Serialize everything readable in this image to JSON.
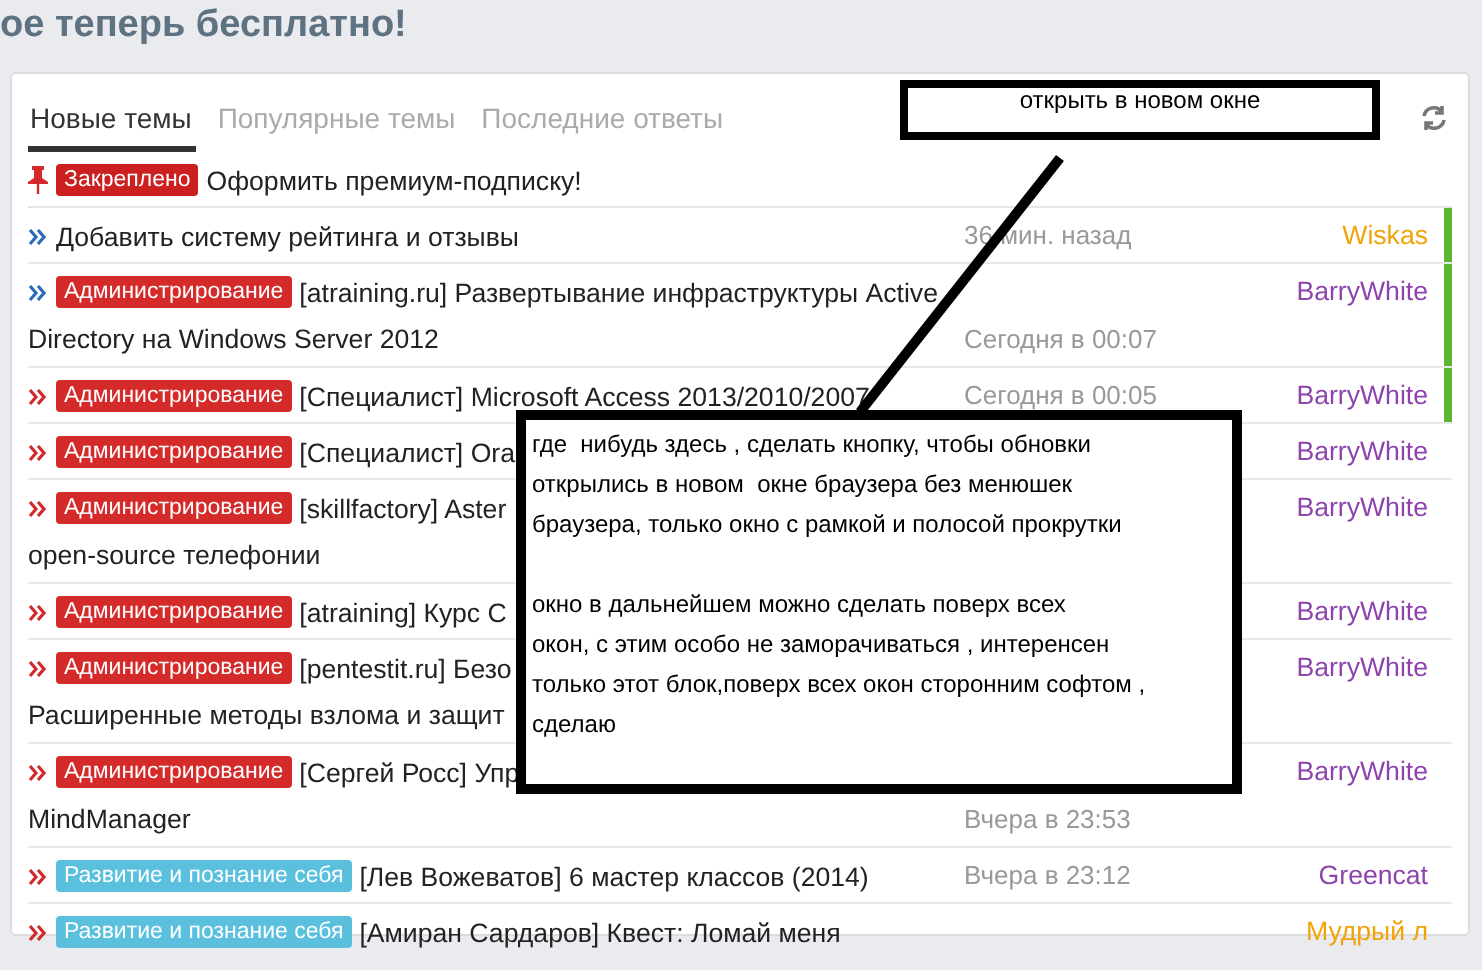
{
  "header": {
    "title": "ое теперь бесплатно!"
  },
  "tabs": [
    {
      "label": "Новые темы",
      "selected": true
    },
    {
      "label": "Популярные темы",
      "selected": false
    },
    {
      "label": "Последние ответы",
      "selected": false
    }
  ],
  "pinned": {
    "tag": {
      "label": "Закреплено",
      "color": "#cc1f1f"
    },
    "title": "Оформить премиум-подписку!"
  },
  "topics": [
    {
      "visited": true,
      "new": true,
      "title": "Добавить систему рейтинга и отзывы",
      "time": "36 мин. назад",
      "user": "Wiskas",
      "color": "#f0a30a"
    },
    {
      "visited": true,
      "new": true,
      "tag": {
        "label": "Администрирование",
        "color": "#d42a2a"
      },
      "title": "[atraining.ru] Развертывание инфраструктуры Active",
      "continuation": "Directory на Windows Server 2012",
      "time": "Сегодня в 00:07",
      "user": "BarryWhite",
      "color": "#8e44ad"
    },
    {
      "visited": false,
      "new": true,
      "tag": {
        "label": "Администрирование",
        "color": "#d42a2a"
      },
      "title": "[Специалист] Microsoft Access 2013/2010/2007",
      "time": "Сегодня в 00:05",
      "user": "BarryWhite",
      "color": "#8e44ad"
    },
    {
      "visited": false,
      "new": false,
      "tag": {
        "label": "Администрирование",
        "color": "#d42a2a"
      },
      "title": "[Специалист] Ora",
      "user": "BarryWhite",
      "color": "#8e44ad"
    },
    {
      "visited": false,
      "new": false,
      "tag": {
        "label": "Администрирование",
        "color": "#d42a2a"
      },
      "title": "[skillfactory] Aster",
      "continuation": "open-source телефонии",
      "user": "BarryWhite",
      "color": "#8e44ad"
    },
    {
      "visited": false,
      "new": false,
      "tag": {
        "label": "Администрирование",
        "color": "#d42a2a"
      },
      "title": "[atraining] Курс C",
      "user": "BarryWhite",
      "color": "#8e44ad"
    },
    {
      "visited": false,
      "new": false,
      "tag": {
        "label": "Администрирование",
        "color": "#d42a2a"
      },
      "title": "[pentestit.ru] Безо",
      "continuation": "Расширенные методы взлома и защит",
      "user": "BarryWhite",
      "color": "#8e44ad"
    },
    {
      "visited": false,
      "new": false,
      "tag": {
        "label": "Администрирование",
        "color": "#d42a2a"
      },
      "title": "[Сергей Росс] Упр",
      "continuation": "MindManager",
      "time": "Вчера в 23:53",
      "user": "BarryWhite",
      "color": "#8e44ad"
    },
    {
      "visited": false,
      "new": false,
      "tag": {
        "label": "Развитие и познание себя",
        "color": "#5bc0de"
      },
      "title": "[Лев Вожеватов] 6 мастер классов (2014)",
      "time": "Вчера в 23:12",
      "user": "Greencat",
      "color": "#8e44ad"
    },
    {
      "visited": false,
      "new": false,
      "tag": {
        "label": "Развитие и познание себя",
        "color": "#5bc0de"
      },
      "title": "[Амиран Сардаров] Квест: Ломай меня",
      "user": "Мудрый л",
      "color": "#f0a30a"
    }
  ],
  "annotations": {
    "callout": "открыть в новом окне",
    "note": [
      [
        "где  нибудь здесь , сделать кнопку, чтобы обновки",
        "открылись в новом  окне браузера без менюшек",
        "браузера, только окно с рамкой и полосой прокрутки"
      ],
      [
        "окно в дальнейшем можно сделать поверх всех",
        "окон, с этим особо не заморачиваться , интеренсен",
        "только этот блок,поверх всех окон сторонним софтом ,",
        "сделаю"
      ]
    ]
  }
}
